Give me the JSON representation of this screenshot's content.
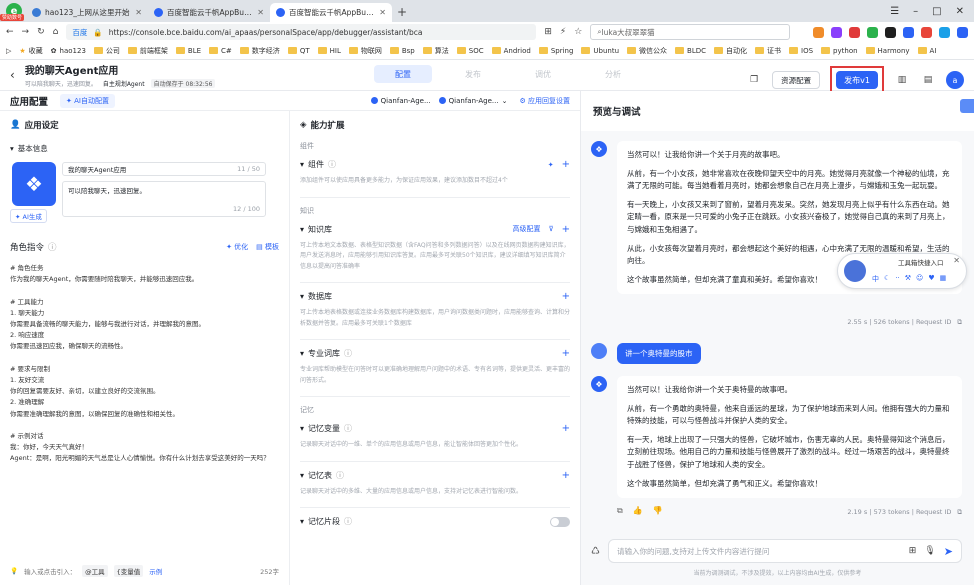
{
  "browser": {
    "badge": "赞助数号",
    "tabs": [
      {
        "title": "hao123_上网从这里开始",
        "fav_color": "#3a7bd5",
        "active": false
      },
      {
        "title": "百度智能云千帆AppBuilder",
        "fav_color": "#2c63f5",
        "active": false
      },
      {
        "title": "百度智能云千帆AppBuilder",
        "fav_color": "#2c63f5",
        "active": true
      }
    ],
    "url": "https://console.bce.baidu.com/ai_apaas/personalSpace/app/debugger/assistant/bca",
    "url_site": "百度",
    "search_text": "luka大叔翠翠猫",
    "bookmarks": [
      "收藏",
      "hao123",
      "公司",
      "前端框架",
      "BLE",
      "C#",
      "数字经济",
      "QT",
      "HIL",
      "物联网",
      "Bsp",
      "算法",
      "SOC",
      "Andriod",
      "Spring",
      "Ubuntu",
      "微信公众",
      "BLDC",
      "自动化",
      "证书",
      "IOS",
      "python",
      "Harmony",
      "AI"
    ],
    "ext_colors": [
      "#f08c2a",
      "#8a3ffc",
      "#e03a3a",
      "#2bb24c",
      "#1f1f1f",
      "#2c63f5",
      "#e8463a",
      "#1aa0e8",
      "#2c63f5"
    ]
  },
  "app": {
    "title": "我的聊天Agent应用",
    "subtitle": "可以陪我聊天，迅速回复。",
    "agent_tag": "自主规划Agent",
    "save_status": "自动保存于 08:32:56",
    "nav": [
      "配置",
      "发布",
      "调优",
      "分析"
    ],
    "resource_btn": "资源配置",
    "publish_btn": "发布v1",
    "avatar": "a"
  },
  "config": {
    "title": "应用配置",
    "ai_config": "AI自动配置",
    "models": [
      "Qianfan-Age...",
      "Qianfan-Age..."
    ],
    "reply_settings": "应用回复设置",
    "settings_title": "应用设定",
    "basic_info": "基本信息",
    "app_name": "我的聊天Agent应用",
    "name_count": "11 / 50",
    "app_desc": "可以陪我聊天，迅速回复。",
    "desc_count": "12 / 100",
    "ai_generate": "AI生成",
    "role_title": "角色指令",
    "optimize": "优化",
    "template": "模板",
    "prompt": "# 角色任务\n作为我的聊天Agent，你需要随时陪我聊天，并能够迅速回应我。\n\n# 工具能力\n1. 聊天能力\n你需要具备流畅的聊天能力，能够与我进行对话，并理解我的意图。\n2. 响应速度\n你需要迅速回应我，确保聊天的流畅性。\n\n# 要求与限制\n1. 友好交流\n你的回复需要友好、亲切，以建立良好的交流氛围。\n2. 准确理解\n你需要准确理解我的意图，以确保回复的准确性和相关性。\n\n# 示例对话\n我：你好，今天天气真好！\nAgent：是啊，阳光明媚的天气总是让人心情愉悦。你有什么计划去享受这美好的一天吗？",
    "footer_hint": "输入或点击引入：",
    "footer_chips": [
      "@工具",
      "{变量值"
    ],
    "footer_example": "示例",
    "word_count": "252字",
    "ability_title": "能力扩展",
    "groups": {
      "components": "组件",
      "knowledge": "知识",
      "memory": "记忆"
    },
    "items": {
      "component": {
        "label": "组件",
        "desc": "添加组件可以使应用具备更多能力，为保证应用效果，建议添加数目不超过4个"
      },
      "kb": {
        "label": "知识库",
        "action": "高级配置",
        "desc": "可上传本地文本数据、表格型知识数据（含FAQ问答和多列数据问答）以及在线网页数据构建知识库，用户发送消息时，应用能够引用知识库答复。应用最多可关联50个知识库，建议详细填写知识库简介信息以提高问答准确率"
      },
      "db": {
        "label": "数据库",
        "desc": "可上传本地表格数据或连接业务数据库构建数据库，用户询问数据类问题时，应用能够查询、计算和分析数据并答复。应用最多可关联1个数据库"
      },
      "glossary": {
        "label": "专业词库",
        "desc": "专业词库帮助模型在问答时可以更准确地理解用户问题中的术语、专有名词等，提供更灵活、更丰富的问答形式。"
      },
      "var": {
        "label": "记忆变量",
        "desc": "记录聊天对话中的一维、单个的应用信息或用户信息，能让智能体回答更加个性化。"
      },
      "table": {
        "label": "记忆表",
        "desc": "记录聊天对话中的多维、大量的应用信息或用户信息，支持对记忆表进行智能问数。"
      },
      "fragment": {
        "label": "记忆片段"
      }
    }
  },
  "preview": {
    "title": "预览与调试",
    "messages": [
      {
        "role": "bot",
        "paragraphs": [
          "当然可以！让我给你讲一个关于月亮的故事吧。",
          "从前，有一个小女孩，她非常喜欢在夜晚仰望天空中的月亮。她觉得月亮就像一个神秘的仙境，充满了无限的可能。每当她看着月亮时，她都会想象自己在月亮上漫步，与嫦娥和玉兔一起玩耍。",
          "有一天晚上，小女孩又来到了窗前，望着月亮发呆。突然，她发现月亮上似乎有什么东西在动。她定睛一看，原来是一只可爱的小兔子正在跳跃。小女孩兴奋极了，她觉得自己真的来到了月亮上，与嫦娥和玉兔相遇了。",
          "从此，小女孩每次望着月亮时，都会想起这个美好的相遇，心中充满了无限的温暖和希望，生活的向往。",
          "这个故事虽然简单，但却充满了童真和美好。希望你喜欢！"
        ],
        "meta": "2.55 s | 526 tokens | Request ID"
      },
      {
        "role": "user",
        "text": "讲一个奥特曼的股市"
      },
      {
        "role": "bot",
        "paragraphs": [
          "当然可以！让我给你讲一个关于奥特曼的故事吧。",
          "从前，有一个勇敢的奥特曼，他来自遥远的星球，为了保护地球而来到人间。他拥有强大的力量和特殊的技能，可以与怪兽战斗并保护人类的安全。",
          "有一天，地球上出现了一只强大的怪兽，它破坏城市，伤害无辜的人民。奥特曼得知这个消息后，立刻前往现场。他用自己的力量和技能与怪兽展开了激烈的战斗。经过一场艰苦的战斗，奥特曼终于战胜了怪兽，保护了地球和人类的安全。",
          "这个故事虽然简单，但却充满了勇气和正义。希望你喜欢！"
        ],
        "meta": "2.19 s | 573 tokens | Request ID"
      }
    ],
    "tool_popup": "工具箱快捷入口",
    "input_placeholder": "请输入你的问题,支持对上传文件内容进行提问",
    "disclaimer": "当前为调测调试，不涉及提效，以上内容均由AI生成，仅供参考"
  }
}
